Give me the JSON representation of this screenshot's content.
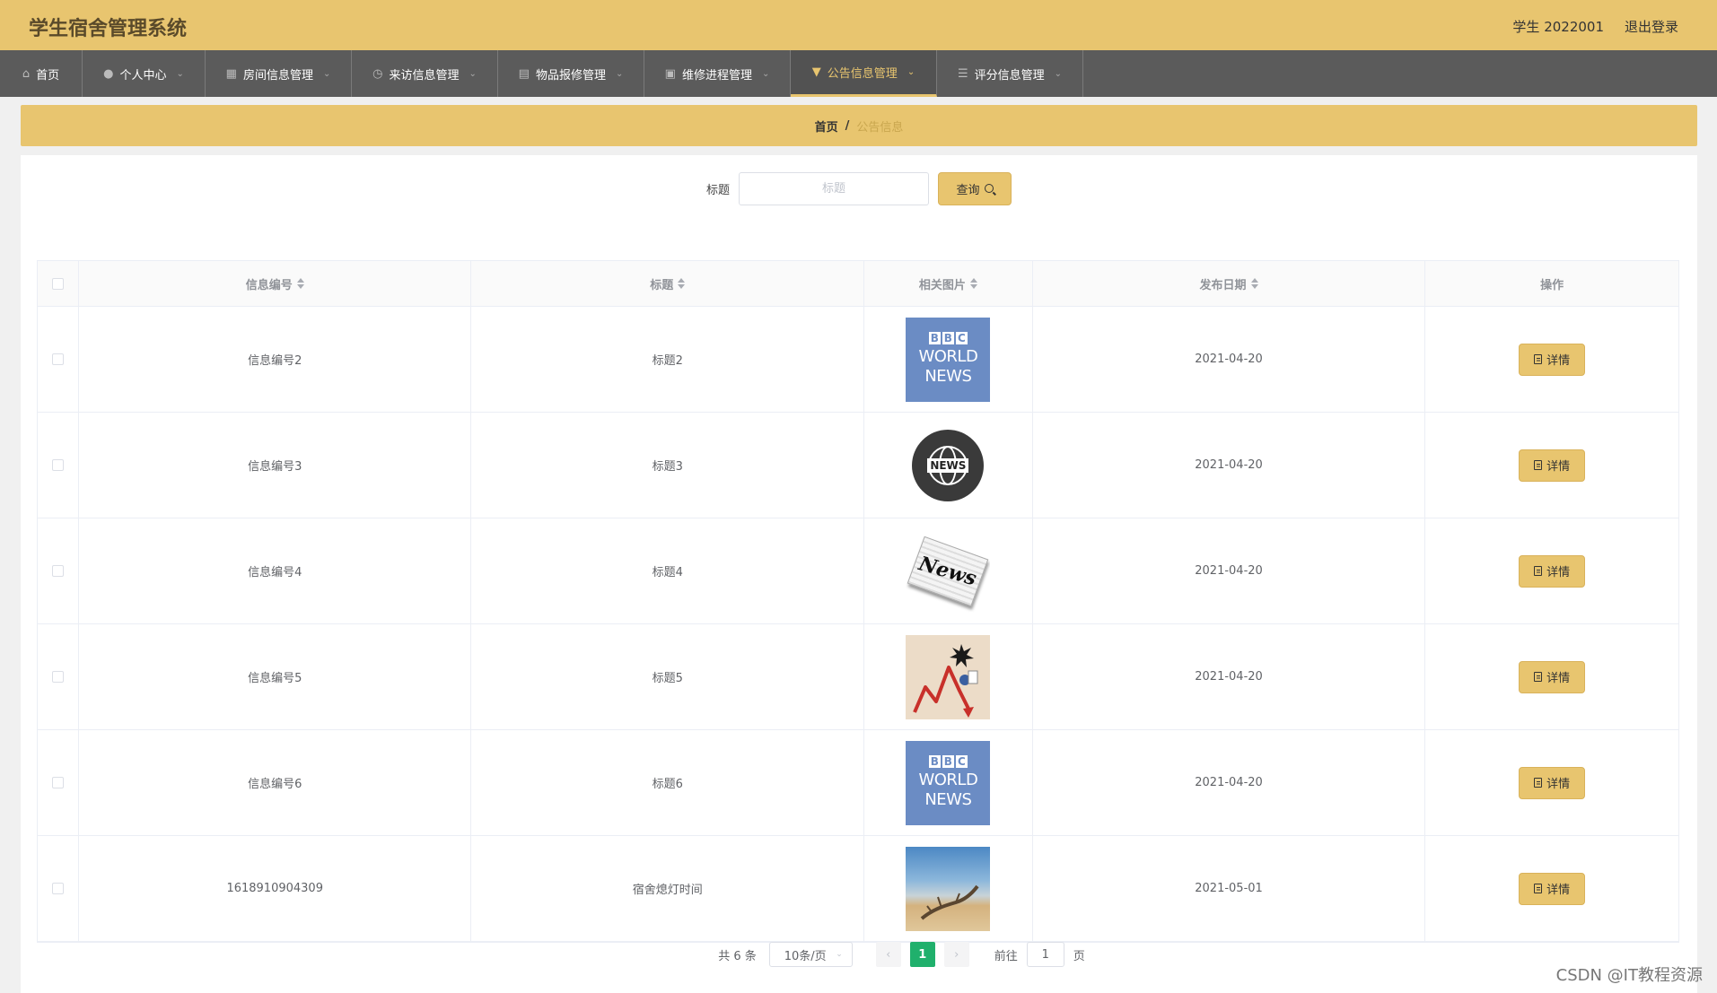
{
  "header": {
    "app_title": "学生宿舍管理系统",
    "user_info": "学生 2022001",
    "logout": "退出登录"
  },
  "nav": {
    "items": [
      {
        "label": "首页",
        "icon": "home-icon",
        "active": false
      },
      {
        "label": "个人中心",
        "icon": "user-icon",
        "active": false
      },
      {
        "label": "房间信息管理",
        "icon": "grid-icon",
        "active": false
      },
      {
        "label": "来访信息管理",
        "icon": "compass-icon",
        "active": false
      },
      {
        "label": "物品报修管理",
        "icon": "card-icon",
        "active": false
      },
      {
        "label": "维修进程管理",
        "icon": "ticket-icon",
        "active": false
      },
      {
        "label": "公告信息管理",
        "icon": "bookmark-icon",
        "active": true
      },
      {
        "label": "评分信息管理",
        "icon": "list-icon",
        "active": false
      }
    ]
  },
  "breadcrumb": {
    "home": "首页",
    "separator": "/",
    "current": "公告信息"
  },
  "search": {
    "label": "标题",
    "placeholder": "标题",
    "value": "",
    "button": "查询"
  },
  "table": {
    "headers": {
      "id": "信息编号",
      "title": "标题",
      "image": "相关图片",
      "date": "发布日期",
      "op": "操作"
    },
    "rows": [
      {
        "id": "信息编号2",
        "title": "标题2",
        "image": "bbc-world-news",
        "date": "2021-04-20",
        "op": "详情"
      },
      {
        "id": "信息编号3",
        "title": "标题3",
        "image": "news-globe",
        "date": "2021-04-20",
        "op": "详情"
      },
      {
        "id": "信息编号4",
        "title": "标题4",
        "image": "newspaper",
        "date": "2021-04-20",
        "op": "详情"
      },
      {
        "id": "信息编号5",
        "title": "标题5",
        "image": "chart-arrow",
        "date": "2021-04-20",
        "op": "详情"
      },
      {
        "id": "信息编号6",
        "title": "标题6",
        "image": "bbc-world-news",
        "date": "2021-04-20",
        "op": "详情"
      },
      {
        "id": "1618910904309",
        "title": "宿舍熄灯时间",
        "image": "beach-photo",
        "date": "2021-05-01",
        "op": "详情"
      }
    ],
    "thumb_text": {
      "bbc": [
        "B",
        "B",
        "C"
      ],
      "bbc_world": "WORLD",
      "bbc_news": "NEWS",
      "globe_label": "NEWS",
      "paper_label": "News"
    }
  },
  "pagination": {
    "total": "共 6 条",
    "page_size": "10条/页",
    "current_page": "1",
    "goto_label": "前往",
    "goto_value": "1",
    "page_suffix": "页"
  },
  "watermark": "CSDN @IT教程资源",
  "colors": {
    "accent": "#e8c56f",
    "nav_bg": "#5b5b5b",
    "page_active": "#20b06c"
  }
}
